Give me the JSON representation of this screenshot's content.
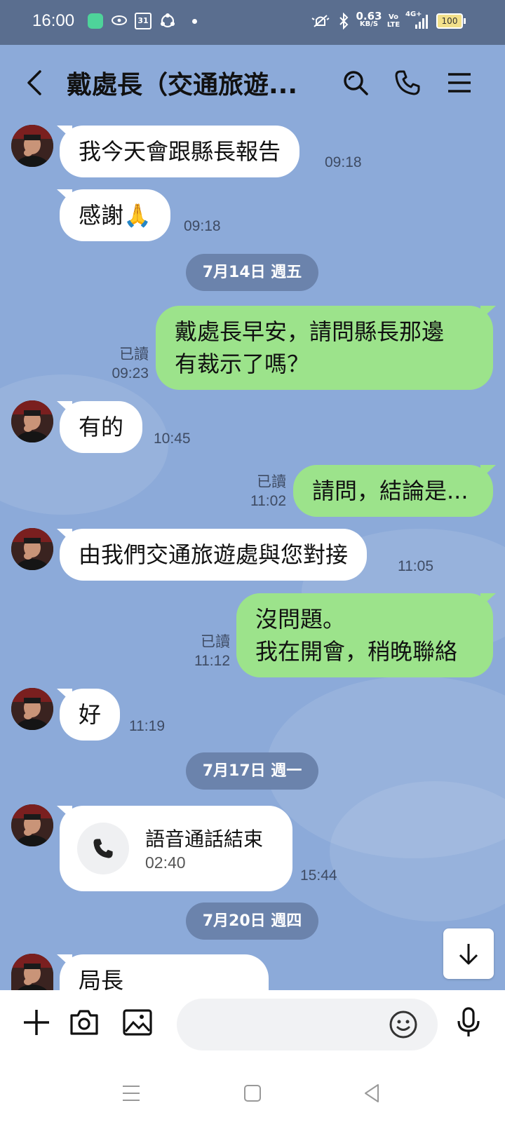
{
  "status": {
    "time": "16:00",
    "calendar_day": "31",
    "net_speed_value": "0.63",
    "net_speed_unit": "KB/S",
    "volte_top": "Vo",
    "volte_bottom": "LTE",
    "network_type": "4G+",
    "battery": "100"
  },
  "header": {
    "title": "戴處長（交通旅遊..."
  },
  "messages": [
    {
      "text": "我今天會跟縣長報告",
      "time": "09:18"
    },
    {
      "text": "感謝🙏",
      "time": "09:18"
    },
    {
      "text": "7月14日 週五"
    },
    {
      "line1": "戴處長早安，請問縣長那邊",
      "line2": "有裁示了嗎？",
      "read": "已讀",
      "time": "09:23"
    },
    {
      "text": "有的",
      "time": "10:45"
    },
    {
      "text": "請問，結論是...",
      "read": "已讀",
      "time": "11:02"
    },
    {
      "text": "由我們交通旅遊處與您對接",
      "time": "11:05"
    },
    {
      "line1": "沒問題。",
      "line2": "我在開會，稍晚聯絡",
      "read": "已讀",
      "time": "11:12"
    },
    {
      "text": "好",
      "time": "11:19"
    },
    {
      "text": "7月17日 週一"
    },
    {
      "call_title": "語音通話結束",
      "call_duration": "02:40",
      "time": "15:44"
    },
    {
      "text": "7月20日 週四"
    },
    {
      "text": "局長"
    }
  ],
  "colors": {
    "chat_background": "#8caad9",
    "outgoing_bubble": "#9ce38b",
    "incoming_bubble": "#ffffff",
    "date_pill": "#6b83ac",
    "status_bar": "#5a6e8f"
  },
  "icons": {
    "back": "chevron-left-icon",
    "search": "search-icon",
    "call": "phone-icon",
    "menu": "menu-icon",
    "add": "plus-icon",
    "camera": "camera-icon",
    "image": "image-icon",
    "emoji": "smiley-icon",
    "voice": "microphone-icon",
    "scroll_down": "arrow-down-icon"
  }
}
